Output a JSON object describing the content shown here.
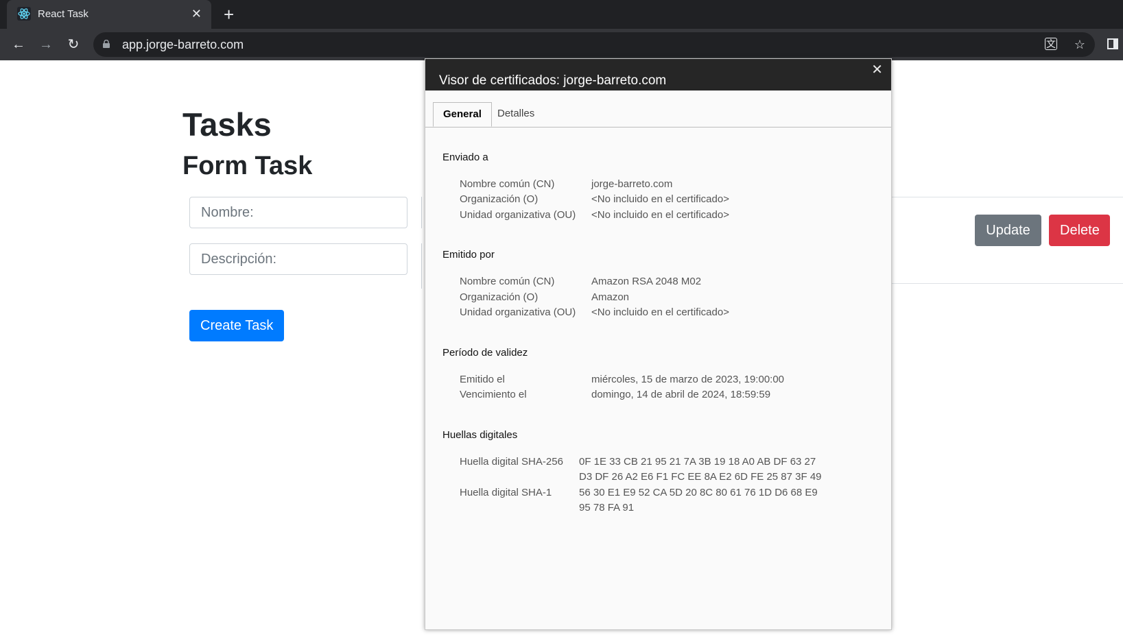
{
  "browser": {
    "tab_title": "React Task",
    "tab_close": "✕",
    "new_tab": "+",
    "url": "app.jorge-barreto.com",
    "back": "←",
    "forward": "→",
    "reload": "↻",
    "translate_icon": "文",
    "bookmark_icon": "☆"
  },
  "page": {
    "title": "Tasks",
    "form_title": "Form Task",
    "name_placeholder": "Nombre:",
    "description_placeholder": "Descripción:",
    "create_button": "Create Task",
    "update_button": "Update",
    "delete_button": "Delete"
  },
  "dialog": {
    "title": "Visor de certificados: jorge-barreto.com",
    "close": "✕",
    "tabs": [
      "General",
      "Detalles"
    ],
    "issued_to": {
      "heading": "Enviado a",
      "rows": [
        {
          "label": "Nombre común (CN)",
          "value": "jorge-barreto.com"
        },
        {
          "label": "Organización (O)",
          "value": "<No incluido en el certificado>"
        },
        {
          "label": "Unidad organizativa (OU)",
          "value": "<No incluido en el certificado>"
        }
      ]
    },
    "issued_by": {
      "heading": "Emitido por",
      "rows": [
        {
          "label": "Nombre común (CN)",
          "value": "Amazon RSA 2048 M02"
        },
        {
          "label": "Organización (O)",
          "value": "Amazon"
        },
        {
          "label": "Unidad organizativa (OU)",
          "value": "<No incluido en el certificado>"
        }
      ]
    },
    "validity": {
      "heading": "Período de validez",
      "rows": [
        {
          "label": "Emitido el",
          "value": "miércoles, 15 de marzo de 2023, 19:00:00"
        },
        {
          "label": "Vencimiento el",
          "value": "domingo, 14 de abril de 2024, 18:59:59"
        }
      ]
    },
    "fingerprints": {
      "heading": "Huellas digitales",
      "sha256_label": "Huella digital SHA-256",
      "sha256_line1": "0F 1E 33 CB 21 95 21 7A 3B 19 18 A0 AB DF 63 27",
      "sha256_line2": "D3 DF 26 A2 E6 F1 FC EE 8A E2 6D FE 25 87 3F 49",
      "sha1_label": "Huella digital SHA-1",
      "sha1_line1": "56 30 E1 E9 52 CA 5D 20 8C 80 61 76 1D D6 68 E9",
      "sha1_line2": "95 78 FA 91"
    }
  }
}
